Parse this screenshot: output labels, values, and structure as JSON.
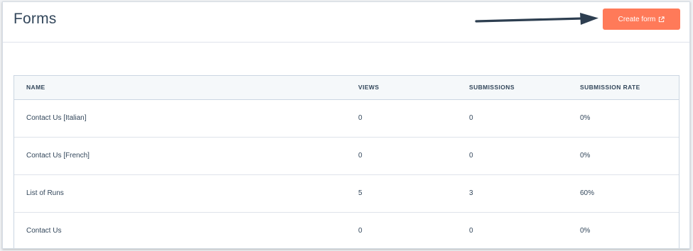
{
  "header": {
    "title": "Forms",
    "create_button": "Create form"
  },
  "table": {
    "columns": [
      "NAME",
      "VIEWS",
      "SUBMISSIONS",
      "SUBMISSION RATE"
    ],
    "rows": [
      {
        "name": "Contact Us [Italian]",
        "views": "0",
        "submissions": "0",
        "rate": "0%"
      },
      {
        "name": "Contact Us [French]",
        "views": "0",
        "submissions": "0",
        "rate": "0%"
      },
      {
        "name": "List of Runs",
        "views": "5",
        "submissions": "3",
        "rate": "60%"
      },
      {
        "name": "Contact Us",
        "views": "0",
        "submissions": "0",
        "rate": "0%"
      }
    ]
  },
  "colors": {
    "accent": "#ff7a59",
    "text": "#33475b",
    "arrow": "#2d3e50"
  }
}
